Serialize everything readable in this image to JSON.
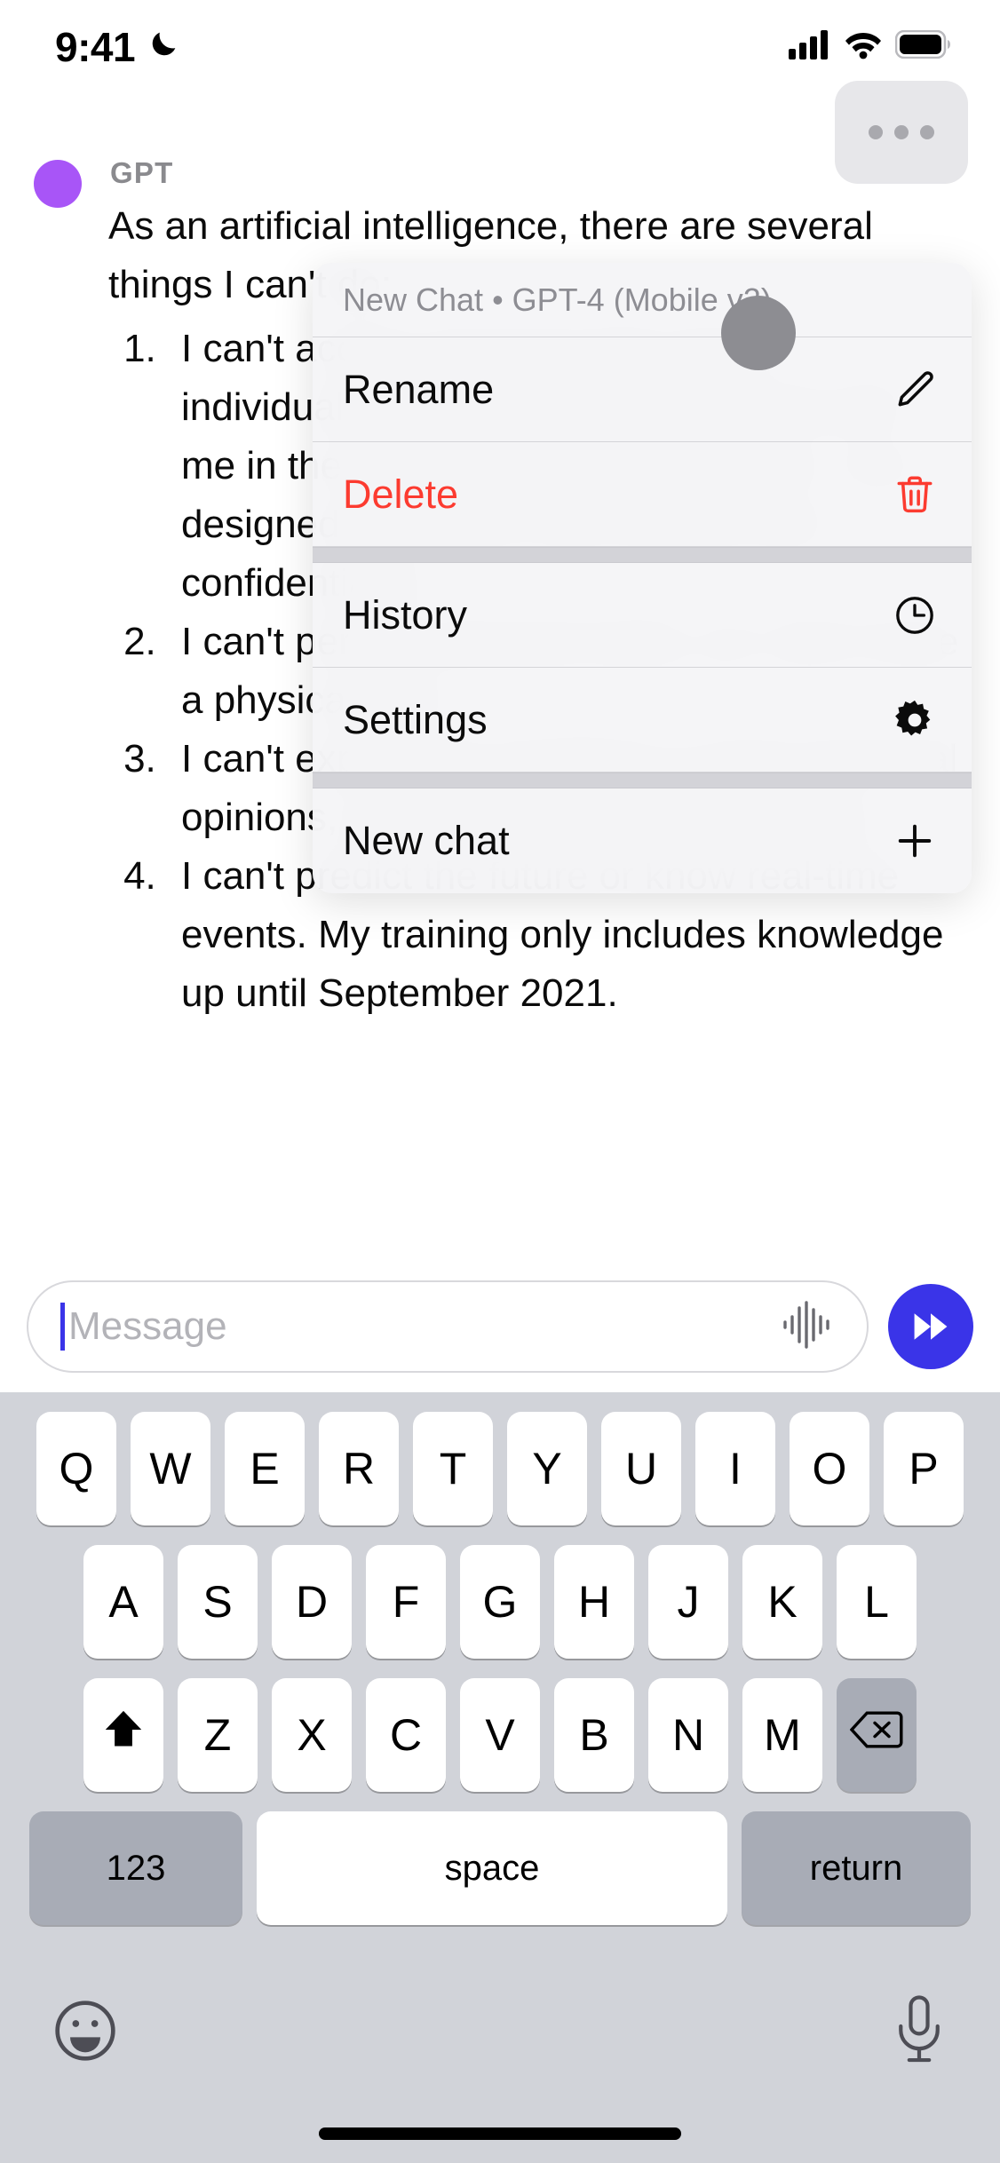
{
  "statusbar": {
    "time": "9:41",
    "dnd_icon": "moon-icon",
    "signal_icon": "cellular-signal-icon",
    "wifi_icon": "wifi-icon",
    "battery_icon": "battery-icon"
  },
  "chat": {
    "sender": "GPT",
    "avatar": "gpt-avatar",
    "intro": "As an artificial intelligence, there are several things I can't do:",
    "list": [
      "I can't access personal data about individuals unless it has been shared with me in the course of our conversation. I am designed to respect user privacy and confidentiality.",
      "I can't perform physical tasks, as I don't have a physical form.",
      "I can't experience emotions or have personal opinions, as I don't have consciousness.",
      "I can't predict the future or know real-time events. My training only includes knowledge up until September 2021."
    ],
    "more_button_label": "More options"
  },
  "context_menu": {
    "header": "New Chat • GPT-4 (Mobile v2)",
    "groups": [
      {
        "items": [
          {
            "label": "Rename",
            "icon": "pencil-icon",
            "style": "default"
          },
          {
            "label": "Delete",
            "icon": "trash-icon",
            "style": "destructive"
          }
        ]
      },
      {
        "items": [
          {
            "label": "History",
            "icon": "clock-icon",
            "style": "default"
          },
          {
            "label": "Settings",
            "icon": "gear-icon",
            "style": "default"
          }
        ]
      },
      {
        "items": [
          {
            "label": "New chat",
            "icon": "plus-icon",
            "style": "default"
          }
        ]
      }
    ]
  },
  "input": {
    "placeholder": "Message",
    "value": "",
    "waveform_icon": "waveform-icon",
    "send_icon": "fast-forward-icon",
    "accent_color": "#3a34e8"
  },
  "keyboard": {
    "row1": [
      "Q",
      "W",
      "E",
      "R",
      "T",
      "Y",
      "U",
      "I",
      "O",
      "P"
    ],
    "row2": [
      "A",
      "S",
      "D",
      "F",
      "G",
      "H",
      "J",
      "K",
      "L"
    ],
    "row3_letters": [
      "Z",
      "X",
      "C",
      "V",
      "B",
      "N",
      "M"
    ],
    "shift_icon": "shift-icon",
    "delete_icon": "backspace-icon",
    "numbers_key": "123",
    "space_key": "space",
    "return_key": "return",
    "emoji_icon": "emoji-icon",
    "mic_icon": "microphone-icon"
  }
}
